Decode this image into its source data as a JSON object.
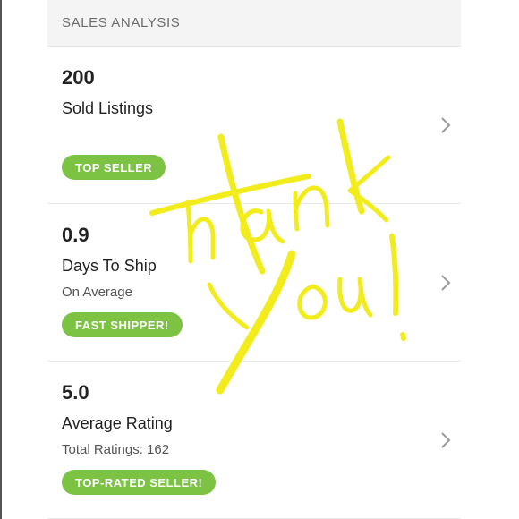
{
  "header": {
    "title": "SALES ANALYSIS"
  },
  "stats": [
    {
      "value": "200",
      "label": "Sold Listings",
      "sublabel": "",
      "badge": "TOP SELLER",
      "icon": "chevron-right-icon"
    },
    {
      "value": "0.9",
      "label": "Days To Ship",
      "sublabel": "On Average",
      "badge": "FAST SHIPPER!",
      "icon": "chevron-right-icon"
    },
    {
      "value": "5.0",
      "label": "Average Rating",
      "sublabel": "Total Ratings: 162",
      "badge": "TOP-RATED SELLER!",
      "icon": "chevron-right-icon"
    }
  ],
  "handwriting": {
    "text": "Thank You!",
    "color": "#f2ec1c"
  },
  "colors": {
    "badge": "#7cc243",
    "header_bg": "#f4f4f4"
  }
}
